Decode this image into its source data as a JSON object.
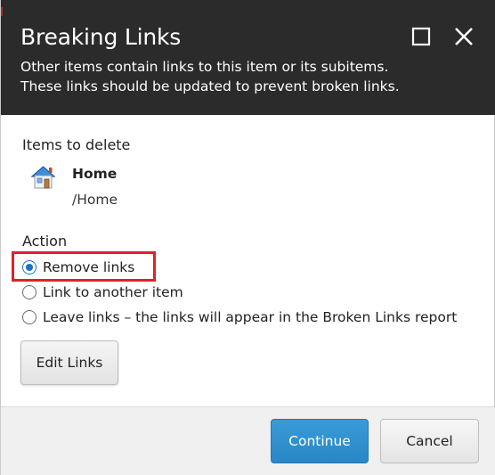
{
  "dialog": {
    "title": "Breaking Links",
    "subtitle_lines": [
      "Other items contain links to this item or its subitems.",
      "These links should be updated to prevent broken links."
    ]
  },
  "items_section": {
    "label": "Items to delete",
    "item": {
      "name": "Home",
      "path": "/Home",
      "icon": "home-icon"
    }
  },
  "action_section": {
    "label": "Action",
    "options": [
      {
        "label": "Remove links",
        "checked": true
      },
      {
        "label": "Link to another item",
        "checked": false
      },
      {
        "label": "Leave links – the links will appear in the Broken Links report",
        "checked": false
      }
    ]
  },
  "buttons": {
    "edit_links": "Edit Links",
    "continue": "Continue",
    "cancel": "Cancel"
  },
  "colors": {
    "header_bg": "#2b2b2b",
    "primary": "#2a86c6",
    "highlight": "#e0202a"
  }
}
